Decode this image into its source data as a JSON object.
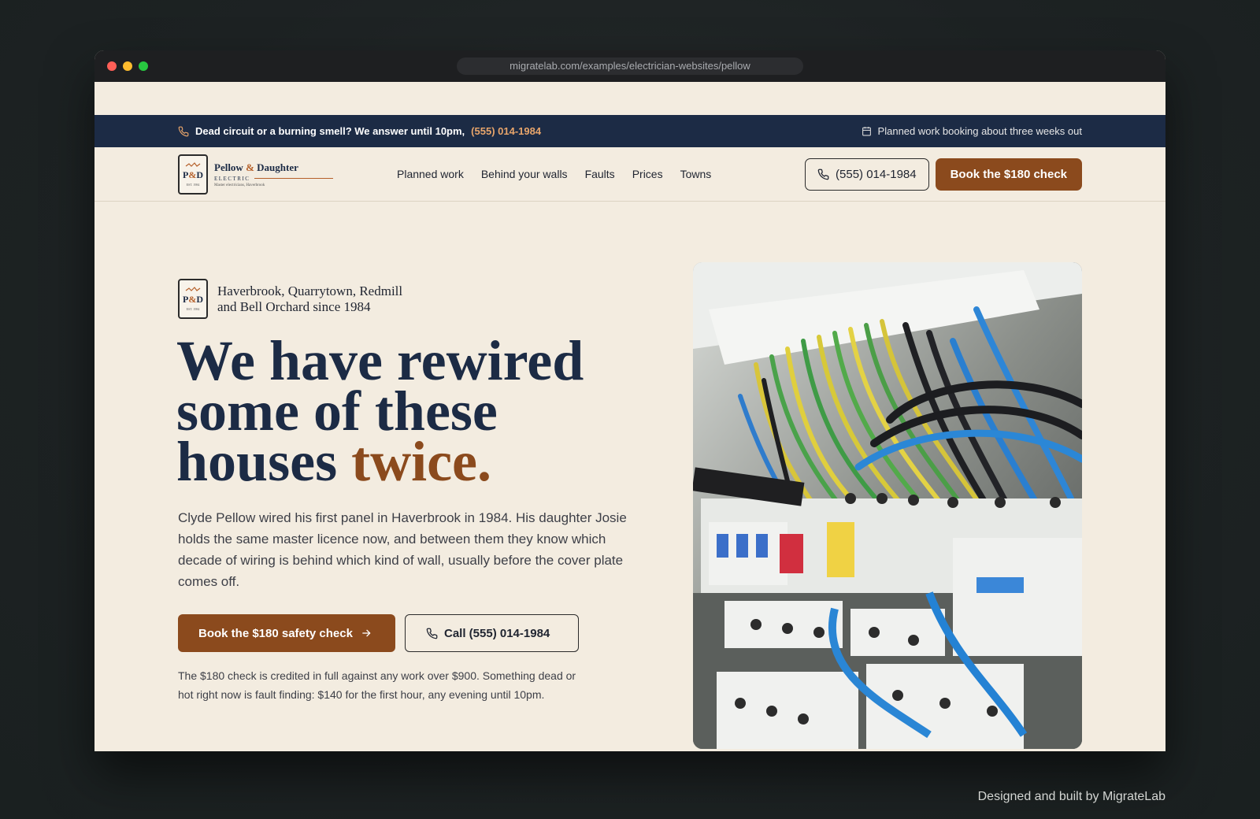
{
  "browser": {
    "url": "migratelab.com/examples/electrician-websites/pellow"
  },
  "alert_bar": {
    "message": "Dead circuit or a burning smell? We answer until 10pm,",
    "phone": "(555) 014-1984",
    "booking_note": "Planned work booking about three weeks out"
  },
  "logo": {
    "monogram_left": "P",
    "monogram_amp": "&",
    "monogram_right": "D",
    "est": "EST. 1984",
    "name_left": "Pellow",
    "name_amp": "&",
    "name_right": "Daughter",
    "subtitle": "ELECTRIC",
    "tagline": "Master electricians, Haverbrook"
  },
  "nav": {
    "items": [
      {
        "label": "Planned work"
      },
      {
        "label": "Behind your walls"
      },
      {
        "label": "Faults"
      },
      {
        "label": "Prices"
      },
      {
        "label": "Towns"
      }
    ],
    "phone_button": "(555) 014-1984",
    "book_button": "Book the $180 check"
  },
  "hero": {
    "locations_line1": "Haverbrook, Quarrytown, Redmill",
    "locations_line2": "and Bell Orchard since 1984",
    "headline_line1": "We have rewired",
    "headline_line2": "some of these",
    "headline_line3": "houses",
    "headline_accent": "twice.",
    "lead": "Clyde Pellow wired his first panel in Haverbrook in 1984. His daughter Josie holds the same master licence now, and between them they know which decade of wiring is behind which kind of wall, usually before the cover plate comes off.",
    "cta_primary": "Book the $180 safety check",
    "cta_secondary": "Call (555) 014-1984",
    "note": "The $180 check is credited in full against any work over $900. Something dead or hot right now is fault finding: $140 for the first hour, any evening until 10pm."
  },
  "footer_credit": "Designed and built by MigrateLab",
  "colors": {
    "navy": "#1c2b45",
    "accent_brown": "#8b4a1d",
    "phone_highlight": "#e8a56b",
    "cream_background": "#f3ece0"
  },
  "icons": [
    "phone-icon",
    "calendar-icon",
    "arrow-right-icon"
  ]
}
